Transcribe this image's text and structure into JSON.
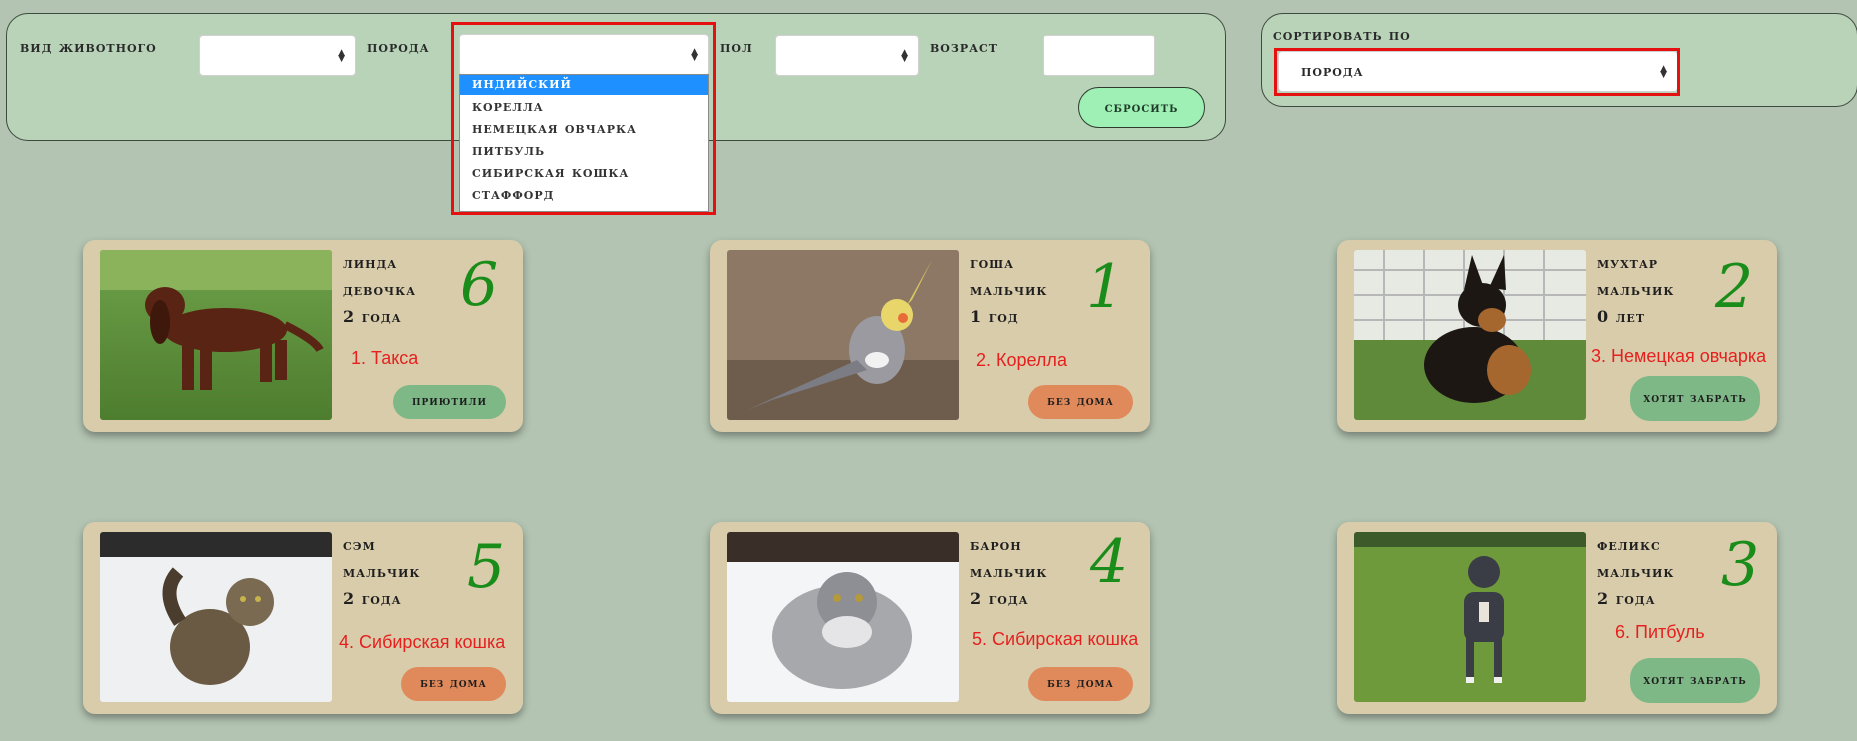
{
  "filters": {
    "animal_type_label": "вид животного",
    "breed_label": "порода",
    "gender_label": "пол",
    "age_label": "возраст",
    "reset_label": "сбросить",
    "breed_options": [
      "индийский",
      "корелла",
      "немецкая овчарка",
      "питбуль",
      "сибирская кошка",
      "стаффорд"
    ],
    "breed_selected_option": "индийский"
  },
  "sort": {
    "label": "сортировать по",
    "value": "порода"
  },
  "cards": [
    {
      "name": "линда",
      "gender": "девочка",
      "age": "2 года",
      "number": "6",
      "note": "1. Такса",
      "status": "приютили",
      "photo": "dachshund-photo"
    },
    {
      "name": "гоша",
      "gender": "мальчик",
      "age": "1 год",
      "number": "1",
      "note": "2. Корелла",
      "status": "без дома",
      "photo": "cockatiel-photo"
    },
    {
      "name": "мухтар",
      "gender": "мальчик",
      "age": "0 лет",
      "number": "2",
      "note": "3. Немецкая овчарка",
      "status": "хотят забрать",
      "photo": "german-shepherd-photo"
    },
    {
      "name": "сэм",
      "gender": "мальчик",
      "age": "2 года",
      "number": "5",
      "note": "4. Сибирская кошка",
      "status": "без дома",
      "photo": "siberian-cat-photo"
    },
    {
      "name": "барон",
      "gender": "мальчик",
      "age": "2 года",
      "number": "4",
      "note": "5. Сибирская кошка",
      "status": "без дома",
      "photo": "siberian-cat-photo"
    },
    {
      "name": "феликс",
      "gender": "мальчик",
      "age": "2 года",
      "number": "3",
      "note": "6. Питбуль",
      "status": "хотят забрать",
      "photo": "pitbull-photo"
    }
  ],
  "colors": {
    "page_bg": "#b3c4b2",
    "panel_bg": "#b8d3b8",
    "card_bg": "#d9ccab",
    "highlight_red": "#e51010",
    "status_green": "#7db886",
    "status_orange": "#e0895a",
    "annotation_green": "#1a8c1a",
    "annotation_red": "#e5201f"
  }
}
